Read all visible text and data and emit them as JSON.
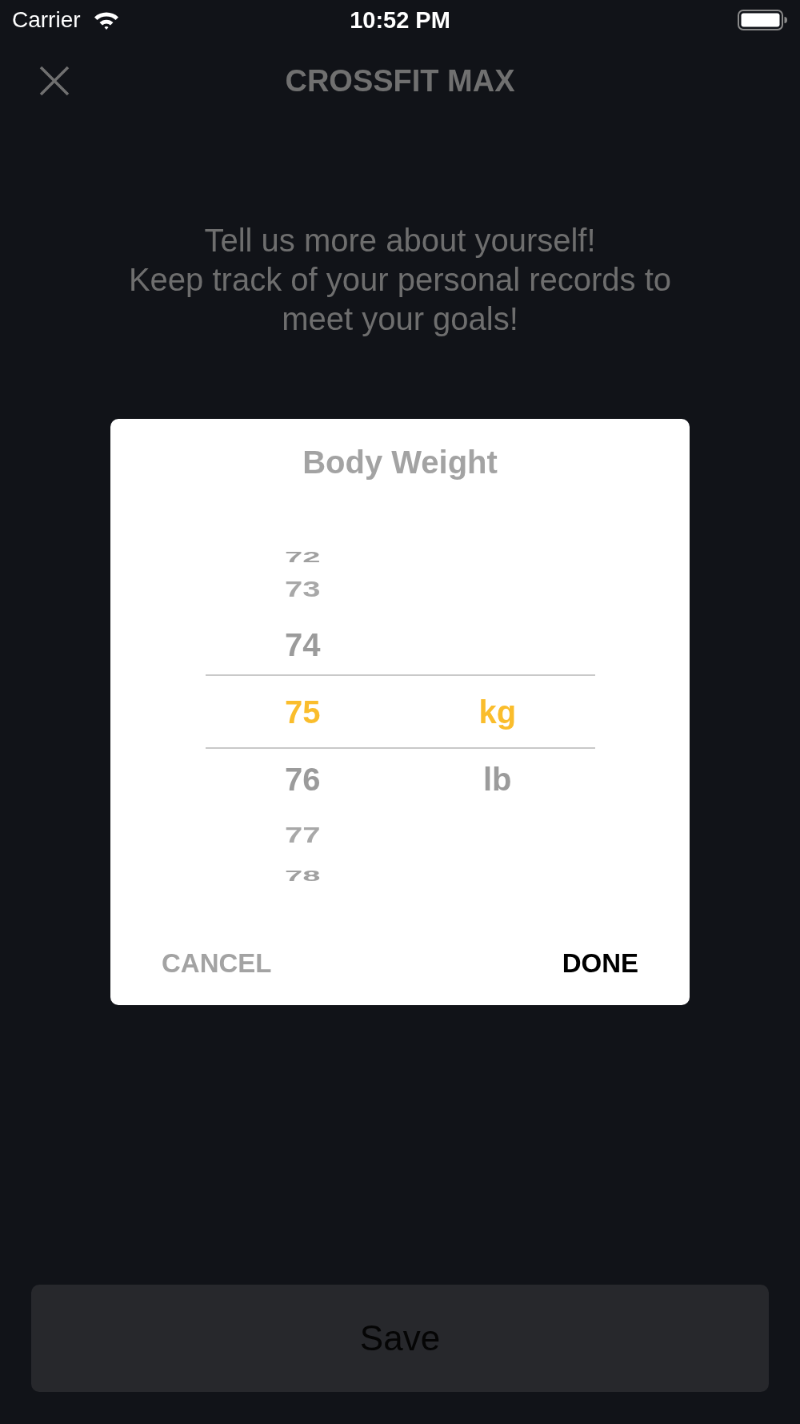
{
  "status_bar": {
    "carrier": "Carrier",
    "time": "10:52 PM"
  },
  "header": {
    "title": "CROSSFIT MAX"
  },
  "intro": "Tell us more about yourself!\nKeep track of your personal records to meet your goals!",
  "modal": {
    "title": "Body Weight",
    "value_column": [
      {
        "label": "72",
        "selected": false
      },
      {
        "label": "73",
        "selected": false
      },
      {
        "label": "74",
        "selected": false
      },
      {
        "label": "75",
        "selected": true
      },
      {
        "label": "76",
        "selected": false
      },
      {
        "label": "77",
        "selected": false
      },
      {
        "label": "78",
        "selected": false
      }
    ],
    "unit_column": [
      {
        "label": "kg",
        "selected": true
      },
      {
        "label": "lb",
        "selected": false
      }
    ],
    "buttons": [
      {
        "label": "CANCEL",
        "kind": "secondary"
      },
      {
        "label": "DONE",
        "kind": "primary"
      }
    ]
  },
  "save_button": {
    "label": "Save"
  }
}
